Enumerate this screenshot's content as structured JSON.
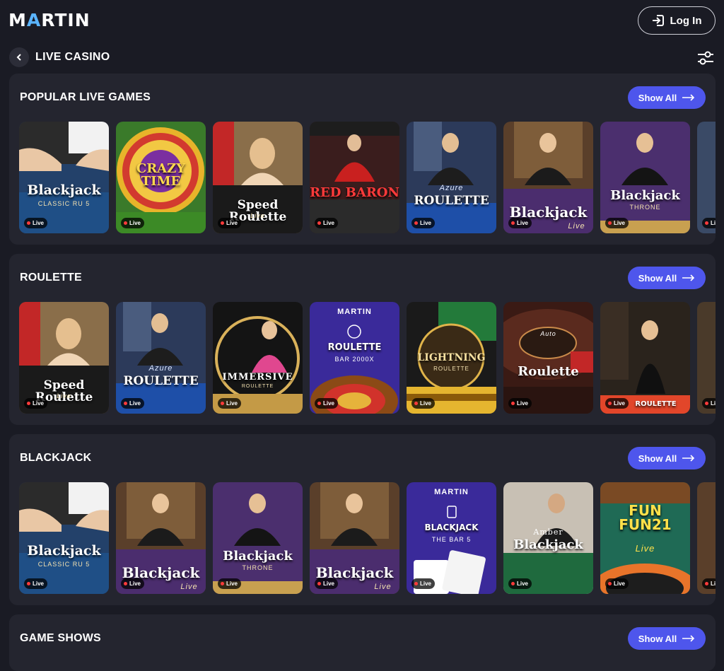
{
  "header": {
    "logo_pre": "M",
    "logo_accent": "A",
    "logo_post": "RTIN",
    "login_label": "Log In"
  },
  "page": {
    "title": "LIVE CASINO"
  },
  "colors": {
    "background": "#1a1b24",
    "panel": "#24252f",
    "accent": "#4e56ec",
    "live_dot": "#ff3b3b"
  },
  "sections": [
    {
      "title": "POPULAR LIVE GAMES",
      "show_all_label": "Show All",
      "cards": [
        {
          "label": "Blackjack",
          "sub": "CLASSIC RU 5",
          "live": "Live"
        },
        {
          "label": "CRAZY TIME",
          "sub": "",
          "live": "Live"
        },
        {
          "label": "Speed Roulette",
          "sub": "Live",
          "live": "Live"
        },
        {
          "label": "RED BARON",
          "sub": "",
          "live": "Live"
        },
        {
          "label": "ROULETTE",
          "sub": "Azure",
          "live": "Live"
        },
        {
          "label": "Blackjack",
          "sub": "Live",
          "live": "Live"
        },
        {
          "label": "Blackjack",
          "sub": "THRONE",
          "live": "Live"
        },
        {
          "label": "",
          "sub": "",
          "live": "Li"
        }
      ]
    },
    {
      "title": "ROULETTE",
      "show_all_label": "Show All",
      "cards": [
        {
          "label": "Speed Roulette",
          "sub": "Live",
          "live": "Live"
        },
        {
          "label": "ROULETTE",
          "sub": "Azure",
          "live": "Live"
        },
        {
          "label": "IMMERSIVE",
          "sub": "ROULETTE",
          "live": "Live"
        },
        {
          "label": "ROULETTE",
          "sub": "BAR 2000X",
          "live": "Live"
        },
        {
          "label": "LIGHTNING",
          "sub": "ROULETTE",
          "live": "Live"
        },
        {
          "label": "Roulette",
          "sub": "Auto",
          "live": "Live"
        },
        {
          "label": "ROULETTE",
          "sub": "",
          "live": "Live"
        },
        {
          "label": "",
          "sub": "",
          "live": "Li"
        }
      ]
    },
    {
      "title": "BLACKJACK",
      "show_all_label": "Show All",
      "cards": [
        {
          "label": "Blackjack",
          "sub": "CLASSIC RU 5",
          "live": "Live"
        },
        {
          "label": "Blackjack",
          "sub": "Live",
          "live": "Live"
        },
        {
          "label": "Blackjack",
          "sub": "THRONE",
          "live": "Live"
        },
        {
          "label": "Blackjack",
          "sub": "Live",
          "live": "Live"
        },
        {
          "label": "BLACKJACK",
          "sub": "THE BAR 5",
          "live": "Live"
        },
        {
          "label": "Blackjack",
          "sub": "Amber",
          "live": "Live"
        },
        {
          "label": "FUN FUN21",
          "sub": "Live",
          "live": "Live"
        },
        {
          "label": "",
          "sub": "",
          "live": "Li"
        }
      ]
    },
    {
      "title": "GAME SHOWS",
      "show_all_label": "Show All",
      "cards": []
    }
  ],
  "card_brand_label": "MARTIN"
}
